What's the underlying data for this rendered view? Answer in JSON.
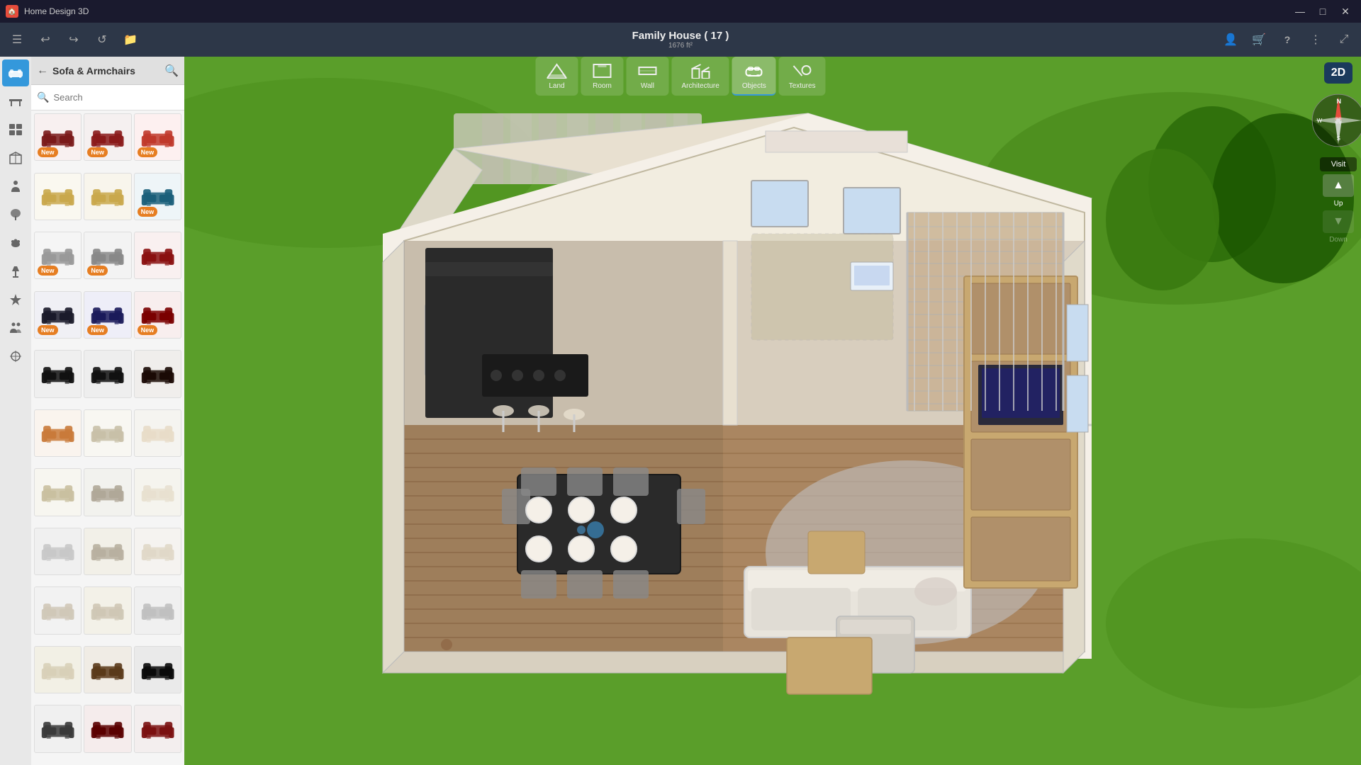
{
  "app": {
    "title": "Home Design 3D",
    "icon": "🏠"
  },
  "titlebar": {
    "minimize": "—",
    "maximize": "□",
    "close": "✕"
  },
  "toolbar": {
    "menu_icon": "☰",
    "undo": "↩",
    "redo": "↪",
    "refresh": "↺",
    "folder": "📁",
    "project_title": "Family House ( 17 )",
    "project_subtitle": "1676 ft²",
    "profile_icon": "👤",
    "cart_icon": "🛒",
    "help_icon": "?",
    "settings_icon": "⋮",
    "expand_icon": "⤢"
  },
  "nav": {
    "items": [
      {
        "id": "land",
        "label": "Land",
        "icon": "⬜"
      },
      {
        "id": "room",
        "label": "Room",
        "icon": "🚪"
      },
      {
        "id": "wall",
        "label": "Wall",
        "icon": "🧱"
      },
      {
        "id": "architecture",
        "label": "Architecture",
        "icon": "🏗️"
      },
      {
        "id": "objects",
        "label": "Objects",
        "icon": "🛋️",
        "active": true
      },
      {
        "id": "textures",
        "label": "Textures",
        "icon": "🎨"
      }
    ]
  },
  "sidebar": {
    "icons": [
      {
        "id": "sofa",
        "icon": "🛋️",
        "active": true
      },
      {
        "id": "table",
        "icon": "🪑"
      },
      {
        "id": "grid",
        "icon": "⊞"
      },
      {
        "id": "box",
        "icon": "📦"
      },
      {
        "id": "person",
        "icon": "👤"
      },
      {
        "id": "tree",
        "icon": "🌿"
      },
      {
        "id": "pet",
        "icon": "🐾"
      },
      {
        "id": "lamp",
        "icon": "💡"
      },
      {
        "id": "star",
        "icon": "⭐"
      },
      {
        "id": "people",
        "icon": "👥"
      },
      {
        "id": "misc",
        "icon": "✦"
      }
    ],
    "category": "Sofa & Armchairs",
    "search_placeholder": "Search",
    "items": [
      {
        "id": 1,
        "color": "#8B0000",
        "new": true,
        "bg": "#f9f0f0"
      },
      {
        "id": 2,
        "color": "#8B0000",
        "new": true,
        "bg": "#f5f0f0"
      },
      {
        "id": 3,
        "color": "#c0392b",
        "new": true,
        "bg": "#fdf0f0"
      },
      {
        "id": 4,
        "color": "#c9a84c",
        "new": false,
        "bg": "#faf8f0"
      },
      {
        "id": 5,
        "color": "#c9a84c",
        "new": false,
        "bg": "#f8f5ec"
      },
      {
        "id": 6,
        "color": "#1a5f7a",
        "new": true,
        "bg": "#eef5f8"
      },
      {
        "id": 7,
        "color": "#aaa",
        "new": true,
        "bg": "#f5f5f5"
      },
      {
        "id": 8,
        "color": "#aaa",
        "new": true,
        "bg": "#f3f3f3"
      },
      {
        "id": 9,
        "color": "#8B0000",
        "new": false,
        "bg": "#f9f0f0"
      },
      {
        "id": 10,
        "color": "#1a1a2a",
        "new": true,
        "bg": "#f0f0f5"
      },
      {
        "id": 11,
        "color": "#1a1a5a",
        "new": true,
        "bg": "#eeeef8"
      },
      {
        "id": 12,
        "color": "#8B0000",
        "new": true,
        "bg": "#f8eeee"
      },
      {
        "id": 13,
        "color": "#111",
        "new": false,
        "bg": "#efefef"
      },
      {
        "id": 14,
        "color": "#111",
        "new": false,
        "bg": "#eeeeee"
      },
      {
        "id": 15,
        "color": "#1a0a05",
        "new": false,
        "bg": "#f0eeec"
      },
      {
        "id": 16,
        "color": "#c97a3a",
        "new": false,
        "bg": "#faf4ee"
      },
      {
        "id": 17,
        "color": "#d0c9b0",
        "new": false,
        "bg": "#f8f7f2"
      },
      {
        "id": 18,
        "color": "#e8e0d0",
        "new": false,
        "bg": "#f5f4f0"
      },
      {
        "id": 19,
        "color": "#c9c0a0",
        "new": false,
        "bg": "#f7f6f0"
      },
      {
        "id": 20,
        "color": "#b0b0a0",
        "new": false,
        "bg": "#f2f2ee"
      },
      {
        "id": 21,
        "color": "#f0ede0",
        "new": false,
        "bg": "#f5f4ee"
      },
      {
        "id": 22,
        "color": "#c8c8c8",
        "new": false,
        "bg": "#f0f0f0"
      },
      {
        "id": 23,
        "color": "#c0b890",
        "new": false,
        "bg": "#f2f0e8"
      },
      {
        "id": 24,
        "color": "#e8e0d8",
        "new": false,
        "bg": "#f5f3f0"
      },
      {
        "id": 25,
        "color": "#e0e0e0",
        "new": false,
        "bg": "#f2f2f2"
      },
      {
        "id": 26,
        "color": "#d0c8b0",
        "new": false,
        "bg": "#f3f1e8"
      },
      {
        "id": 27,
        "color": "#bfbfbf",
        "new": false,
        "bg": "#f0f0f0"
      },
      {
        "id": 28,
        "color": "#ddd8c0",
        "new": false,
        "bg": "#f2f0e5"
      },
      {
        "id": 29,
        "color": "#5a3a1a",
        "new": false,
        "bg": "#f0ece5"
      },
      {
        "id": 30,
        "color": "#0a0a0a",
        "new": false,
        "bg": "#eaeaea"
      }
    ]
  },
  "view2d": "2D",
  "compass": {
    "n": "N",
    "w": "W",
    "s": "S"
  },
  "view_controls": {
    "visit": "Visit",
    "up": "▲",
    "down": "▼"
  }
}
